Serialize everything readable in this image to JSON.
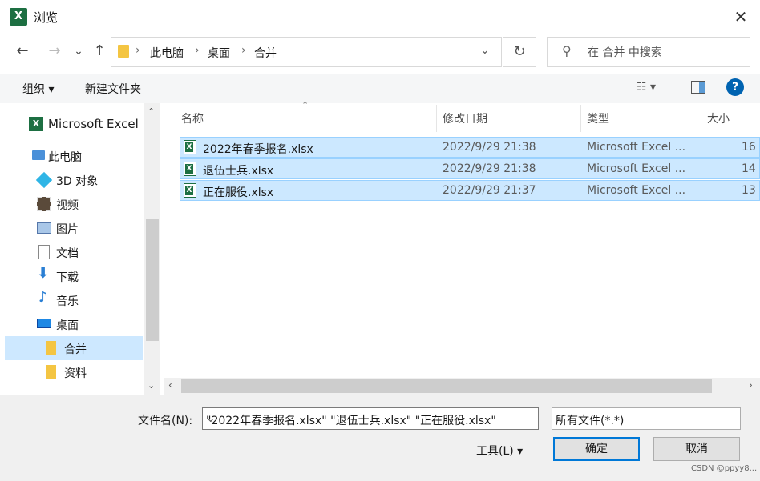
{
  "window": {
    "title": "浏览",
    "app_icon_letter": "X",
    "close_glyph": "✕"
  },
  "nav": {
    "back": "←",
    "forward": "→",
    "recent": "⌄",
    "up": "↑",
    "breadcrumb": [
      "此电脑",
      "桌面",
      "合并"
    ],
    "refresh": "↻",
    "search_placeholder": "在 合并 中搜索"
  },
  "toolbar": {
    "organize": "组织 ▾",
    "new_folder": "新建文件夹",
    "view_glyph": "☷ ▾",
    "help": "?"
  },
  "sidebar": {
    "items": [
      {
        "label": "Microsoft Excel",
        "icon": "excel-icon"
      },
      {
        "label": "此电脑",
        "icon": "computer-icon"
      },
      {
        "label": "3D 对象",
        "icon": "cube-icon"
      },
      {
        "label": "视频",
        "icon": "video-icon"
      },
      {
        "label": "图片",
        "icon": "picture-icon"
      },
      {
        "label": "文档",
        "icon": "document-icon"
      },
      {
        "label": "下载",
        "icon": "download-icon"
      },
      {
        "label": "音乐",
        "icon": "music-icon"
      },
      {
        "label": "桌面",
        "icon": "desktop-icon"
      },
      {
        "label": "合并",
        "icon": "folder-icon"
      },
      {
        "label": "资料",
        "icon": "folder-icon"
      }
    ]
  },
  "columns": {
    "name": "名称",
    "date": "修改日期",
    "type": "类型",
    "size": "大小"
  },
  "files": [
    {
      "name": "2022年春季报名.xlsx",
      "date": "2022/9/29 21:38",
      "type": "Microsoft Excel ...",
      "size": "16"
    },
    {
      "name": "退伍士兵.xlsx",
      "date": "2022/9/29 21:38",
      "type": "Microsoft Excel ...",
      "size": "14"
    },
    {
      "name": "正在服役.xlsx",
      "date": "2022/9/29 21:37",
      "type": "Microsoft Excel ...",
      "size": "13"
    }
  ],
  "bottom": {
    "filename_label": "文件名(N):",
    "filename_value": "\"2022年春季报名.xlsx\" \"退伍士兵.xlsx\" \"正在服役.xlsx\"",
    "filter": "所有文件(*.*)",
    "tools": "工具(L)  ▾",
    "ok": "确定",
    "cancel": "取消",
    "watermark": "CSDN @ppyy8..."
  },
  "colors": {
    "selection_bg": "#cce8ff",
    "selection_border": "#99d1ff",
    "excel_green": "#1d6f42",
    "accent": "#0078d7"
  }
}
